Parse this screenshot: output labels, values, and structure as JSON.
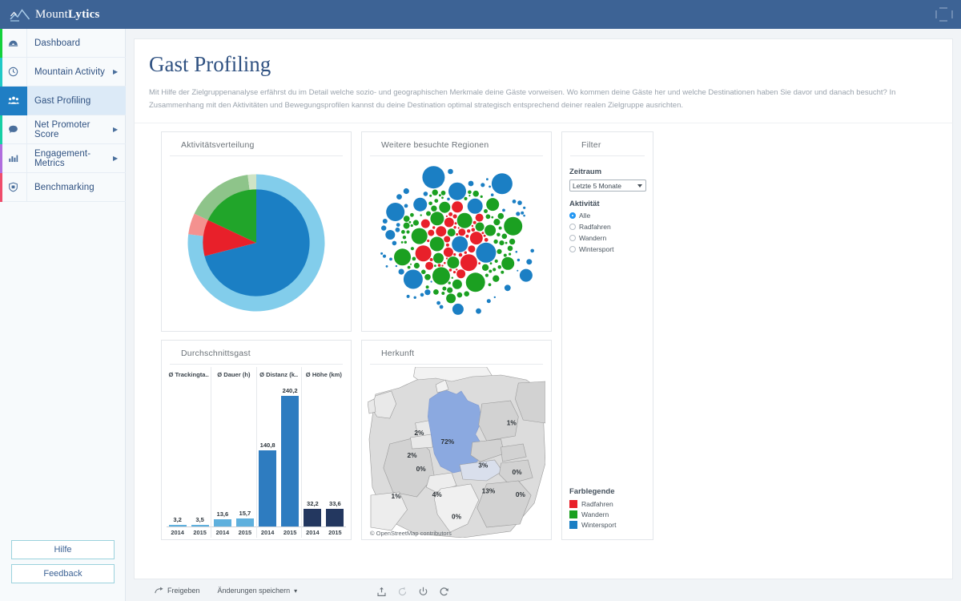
{
  "app": {
    "brand_prefix": "Mount",
    "brand_suffix": "Lytics",
    "logo_icon": "mountain-icon"
  },
  "sidebar": {
    "items": [
      {
        "label": "Dashboard",
        "icon": "dashboard-icon",
        "accent": "#13d13b",
        "caret": "",
        "active": false
      },
      {
        "label": "Mountain Activity",
        "icon": "clock-icon",
        "accent": "#20c9c6",
        "caret": "▶",
        "active": false
      },
      {
        "label": "Gast Profiling",
        "icon": "users-icon",
        "accent": "#1f7ec4",
        "caret": "",
        "active": true
      },
      {
        "label": "Net Promoter Score",
        "icon": "comment-icon",
        "accent": "#17cfa5",
        "caret": "▶",
        "active": false
      },
      {
        "label": "Engagement-Metrics",
        "icon": "barchart-icon",
        "accent": "#b06ede",
        "caret": "▶",
        "active": false
      },
      {
        "label": "Benchmarking",
        "icon": "shield-icon",
        "accent": "#ef4c6b",
        "caret": "",
        "active": false
      }
    ],
    "help_button": "Hilfe",
    "feedback_button": "Feedback"
  },
  "header": {
    "title": "Gast Profiling",
    "description": "Mit Hilfe der Zielgruppenanalyse erfährst du im Detail welche sozio- und geographischen Merkmale deine Gäste vorweisen. Wo kommen deine Gäste her und welche Destinationen haben Sie davor und danach besucht? In Zusammenhang mit den Aktivitäten und Bewegungsprofilen kannst du deine Destination optimal strategisch entsprechend deiner realen Zielgruppe ausrichten."
  },
  "panels": {
    "activity": {
      "title": "Aktivitätsverteilung"
    },
    "regions": {
      "title": "Weitere besuchte Regionen"
    },
    "filter": {
      "title": "Filter"
    },
    "average": {
      "title": "Durchschnittsgast"
    },
    "origin": {
      "title": "Herkunft"
    }
  },
  "filter": {
    "zeitraum_label": "Zeitraum",
    "zeitraum_value": "Letzte 5 Monate",
    "aktivitaet_label": "Aktivität",
    "options": [
      {
        "label": "Alle",
        "selected": true
      },
      {
        "label": "Radfahren",
        "selected": false
      },
      {
        "label": "Wandern",
        "selected": false
      },
      {
        "label": "Wintersport",
        "selected": false
      }
    ]
  },
  "legend": {
    "title": "Farblegende",
    "items": [
      {
        "label": "Radfahren",
        "color": "#e8202a"
      },
      {
        "label": "Wandern",
        "color": "#1ba021"
      },
      {
        "label": "Wintersport",
        "color": "#1b7fc4"
      }
    ]
  },
  "toolbar": {
    "share_label": "Freigeben",
    "save_label": "Änderungen speichern",
    "share_icon": "share-arrow-icon",
    "save_caret": "▾",
    "icons": [
      "export-icon",
      "undo-icon",
      "power-icon",
      "refresh-icon"
    ]
  },
  "map_attribution": "© OpenStreetMap contributors",
  "chart_data": [
    {
      "type": "pie",
      "name": "Aktivitätsverteilung",
      "title": "Aktivitätsverteilung",
      "legend": "none",
      "rings": [
        {
          "name": "Innenring",
          "labels": [
            "Wintersport",
            "Radfahren",
            "Wandern"
          ],
          "values": [
            71,
            11,
            18
          ],
          "colors": [
            "#1b7fc4",
            "#e8202a",
            "#21a52a"
          ]
        },
        {
          "name": "Außenring",
          "labels": [
            "Wintersport",
            "Radfahren",
            "Wandern",
            "Sonstige"
          ],
          "values": [
            77,
            5,
            16,
            2
          ],
          "colors": [
            "#82cdeb",
            "#f4918f",
            "#8ec48a",
            "#cfe4c5"
          ]
        }
      ]
    },
    {
      "type": "bubble",
      "name": "Weitere besuchte Regionen",
      "title": "Weitere besuchte Regionen",
      "categories": [
        "Radfahren",
        "Wandern",
        "Wintersport"
      ],
      "colors": [
        "#e8202a",
        "#1ba021",
        "#1b7fc4"
      ],
      "note": "Packed-circle Diagramm: roter Kern, grüner Mittelring, blaue Außenkreise"
    },
    {
      "type": "bar",
      "name": "Durchschnittsgast",
      "title": "Durchschnittsgast",
      "categories": [
        "2014",
        "2015"
      ],
      "ylim": [
        0,
        250
      ],
      "grid": false,
      "groups": [
        {
          "label": "Ø Trackingta..",
          "full_label": "Ø Trackingtage",
          "values": [
            3.2,
            3.5
          ],
          "value_labels": [
            "3,2",
            "3,5"
          ],
          "color": "#5fb0dd"
        },
        {
          "label": "Ø Dauer (h)",
          "full_label": "Ø Dauer (h)",
          "values": [
            13.6,
            15.7
          ],
          "value_labels": [
            "13,6",
            "15,7"
          ],
          "color": "#5fb0dd"
        },
        {
          "label": "Ø Distanz (k..",
          "full_label": "Ø Distanz (km)",
          "values": [
            140.8,
            240.2
          ],
          "value_labels": [
            "140,8",
            "240,2"
          ],
          "color": "#2e7cc0"
        },
        {
          "label": "Ø Höhe (km)",
          "full_label": "Ø Höhe (km)",
          "values": [
            32.2,
            33.6
          ],
          "value_labels": [
            "32,2",
            "33,6"
          ],
          "color": "#23375f"
        }
      ]
    },
    {
      "type": "map",
      "name": "Herkunft",
      "title": "Herkunft",
      "unit": "%",
      "highlight_color": "#8ba9e0",
      "regions": [
        {
          "label": "2%",
          "x": 29,
          "y": 40
        },
        {
          "label": "2%",
          "x": 25,
          "y": 53
        },
        {
          "label": "0%",
          "x": 30,
          "y": 61
        },
        {
          "label": "72%",
          "x": 45,
          "y": 45
        },
        {
          "label": "1%",
          "x": 81,
          "y": 34
        },
        {
          "label": "3%",
          "x": 65,
          "y": 59
        },
        {
          "label": "0%",
          "x": 84,
          "y": 63
        },
        {
          "label": "13%",
          "x": 68,
          "y": 74
        },
        {
          "label": "0%",
          "x": 86,
          "y": 76
        },
        {
          "label": "4%",
          "x": 39,
          "y": 76
        },
        {
          "label": "1%",
          "x": 16,
          "y": 77
        },
        {
          "label": "0%",
          "x": 50,
          "y": 89
        }
      ]
    }
  ]
}
